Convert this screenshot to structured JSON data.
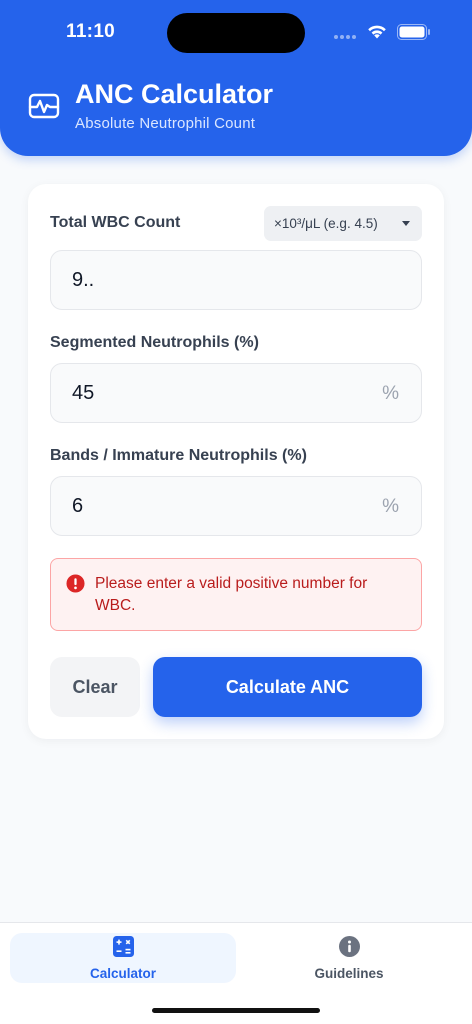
{
  "status_bar": {
    "time": "11:10"
  },
  "header": {
    "title": "ANC Calculator",
    "subtitle": "Absolute Neutrophil Count",
    "icon": "activity-monitor-icon"
  },
  "form": {
    "wbc": {
      "label": "Total WBC Count",
      "unit_selected": "×10³/μL (e.g. 4.5)",
      "value": "9.."
    },
    "segmented": {
      "label": "Segmented Neutrophils (%)",
      "value": "45",
      "suffix": "%"
    },
    "bands": {
      "label": "Bands / Immature Neutrophils (%)",
      "value": "6",
      "suffix": "%"
    },
    "error": {
      "message": "Please enter a valid positive number for WBC.",
      "icon": "error-circle-icon"
    },
    "buttons": {
      "clear_label": "Clear",
      "calculate_label": "Calculate ANC"
    }
  },
  "tab_bar": {
    "tabs": [
      {
        "label": "Calculator",
        "icon": "calculator-icon",
        "active": true
      },
      {
        "label": "Guidelines",
        "icon": "info-icon",
        "active": false
      }
    ]
  },
  "colors": {
    "primary": "#2563eb",
    "error_text": "#b91c1c",
    "error_bg": "#fef2f2",
    "background": "#f8fafc"
  }
}
